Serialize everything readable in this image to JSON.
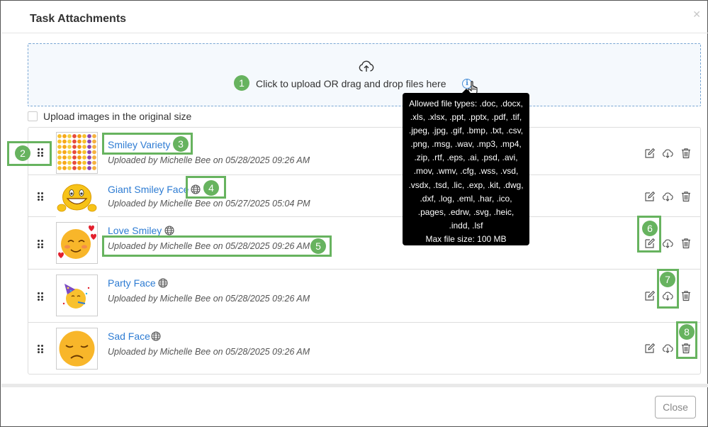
{
  "dialog": {
    "title": "Task Attachments",
    "close_icon": "close-x-icon",
    "close_button": "Close"
  },
  "upload": {
    "icon": "cloud-upload-icon",
    "text": "Click to upload OR drag and drop files here",
    "info_icon": "info-icon",
    "tooltip_types": "Allowed file types: .doc, .docx, .xls, .xlsx, .ppt, .pptx, .pdf, .tif, .jpeg, .jpg, .gif, .bmp, .txt, .csv, .png, .msg, .wav, .mp3, .mp4, .zip, .rtf, .eps, .ai, .psd, .avi, .mov, .wmv, .cfg, .wss, .vsd, .vsdx, .tsd, .lic, .exp, .kit, .dwg, .dxf, .log, .eml, .har, .ico, .pages, .edrw, .svg, .heic, .indd, .lsf",
    "tooltip_lines": [
      "Allowed file types: .doc, .docx,",
      ".xls, .xlsx, .ppt, .pptx, .pdf, .tif,",
      ".jpeg, .jpg, .gif, .bmp, .txt, .csv,",
      ".png, .msg, .wav, .mp3, .mp4,",
      ".zip, .rtf, .eps, .ai, .psd, .avi,",
      ".mov, .wmv, .cfg, .wss, .vsd,",
      ".vsdx, .tsd, .lic, .exp, .kit, .dwg,",
      ".dxf, .log, .eml, .har, .ico,",
      ".pages, .edrw, .svg, .heic,",
      ".indd, .lsf"
    ],
    "max_size": "Max file size: 100 MB",
    "original_size_label": "Upload images in the original size"
  },
  "attachments": [
    {
      "name": "Smiley Variety",
      "meta": "Uploaded by Michelle Bee on 05/28/2025 09:26 AM",
      "public": false,
      "thumb": "smiley-grid"
    },
    {
      "name": "Giant Smiley Face",
      "meta": "Uploaded by Michelle Bee on 05/27/2025 05:04 PM",
      "public": true,
      "thumb": "giant-smiley"
    },
    {
      "name": "Love Smiley",
      "meta": "Uploaded by Michelle Bee on 05/28/2025 09:26 AM",
      "public": true,
      "thumb": "love-smiley"
    },
    {
      "name": "Party Face",
      "meta": "Uploaded by Michelle Bee on 05/28/2025 09:26 AM",
      "public": true,
      "thumb": "party-face"
    },
    {
      "name": "Sad Face",
      "meta": "Uploaded by Michelle Bee on 05/28/2025 09:26 AM",
      "public": true,
      "thumb": "sad-face"
    }
  ],
  "row_icons": {
    "drag": "drag-handle-icon",
    "globe": "globe-icon",
    "edit": "edit-icon",
    "download": "download-icon",
    "delete": "trash-icon"
  },
  "callouts": [
    "1",
    "2",
    "3",
    "4",
    "5",
    "6",
    "7",
    "8"
  ],
  "colors": {
    "link": "#2e7cd3",
    "callout": "#67b35f",
    "tooltip_bg": "#000000"
  }
}
